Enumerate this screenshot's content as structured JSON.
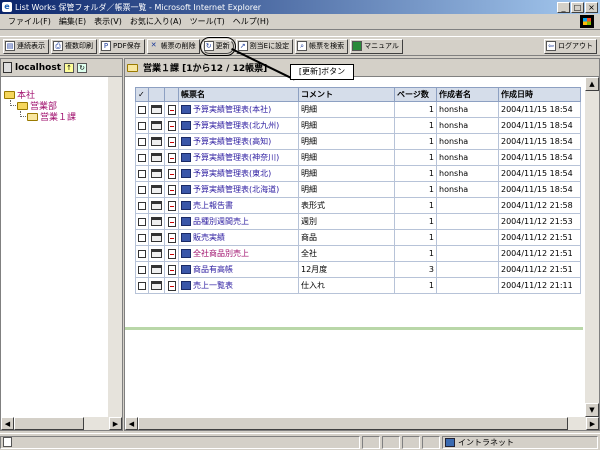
{
  "window": {
    "title": "List Works 保管フォルダ／帳票一覧 - Microsoft Internet Explorer",
    "controls": [
      "_",
      "□",
      "×"
    ]
  },
  "menu": [
    "ファイル(F)",
    "編集(E)",
    "表示(V)",
    "お気に入り(A)",
    "ツール(T)",
    "ヘルプ(H)"
  ],
  "toolbar": {
    "buttons": [
      "連続表示",
      "複数印刷",
      "PDF保存",
      "帳票の削除",
      "更新",
      "割当Eに設定",
      "帳票を検索",
      "マニュアル"
    ],
    "logout": "ログアウト"
  },
  "callout": {
    "label": "[更新]ボタン"
  },
  "left_pane": {
    "host": "localhost",
    "tree": [
      "本社",
      "営業部",
      "営業１課"
    ]
  },
  "right_pane": {
    "header": "営業１課 [1から12 / 12帳票]",
    "columns": [
      "✓",
      "帳票名",
      "コメント",
      "ページ数",
      "作成者名",
      "作成日時"
    ],
    "rows": [
      {
        "name": "予算実績管理表(本社)",
        "comment": "明細",
        "pages": "1",
        "author": "honsha",
        "date": "2004/11/15 18:54"
      },
      {
        "name": "予算実績管理表(北九州)",
        "comment": "明細",
        "pages": "1",
        "author": "honsha",
        "date": "2004/11/15 18:54"
      },
      {
        "name": "予算実績管理表(高知)",
        "comment": "明細",
        "pages": "1",
        "author": "honsha",
        "date": "2004/11/15 18:54"
      },
      {
        "name": "予算実績管理表(神奈川)",
        "comment": "明細",
        "pages": "1",
        "author": "honsha",
        "date": "2004/11/15 18:54"
      },
      {
        "name": "予算実績管理表(東北)",
        "comment": "明細",
        "pages": "1",
        "author": "honsha",
        "date": "2004/11/15 18:54"
      },
      {
        "name": "予算実績管理表(北海道)",
        "comment": "明細",
        "pages": "1",
        "author": "honsha",
        "date": "2004/11/15 18:54"
      },
      {
        "name": "売上報告書",
        "comment": "表形式",
        "pages": "1",
        "author": "",
        "date": "2004/11/12 21:58"
      },
      {
        "name": "品種別週間売上",
        "comment": "週別",
        "pages": "1",
        "author": "",
        "date": "2004/11/12 21:53"
      },
      {
        "name": "販売実績",
        "comment": "商品",
        "pages": "1",
        "author": "",
        "date": "2004/11/12 21:51"
      },
      {
        "name": "全社商品別売上",
        "comment": "全社",
        "pages": "1",
        "author": "",
        "date": "2004/11/12 21:51"
      },
      {
        "name": "商品有高帳",
        "comment": "12月度",
        "pages": "3",
        "author": "",
        "date": "2004/11/12 21:51"
      },
      {
        "name": "売上一覧表",
        "comment": "仕入れ",
        "pages": "1",
        "author": "",
        "date": "2004/11/12 21:11"
      }
    ]
  },
  "statusbar": {
    "zone": "イントラネット"
  }
}
